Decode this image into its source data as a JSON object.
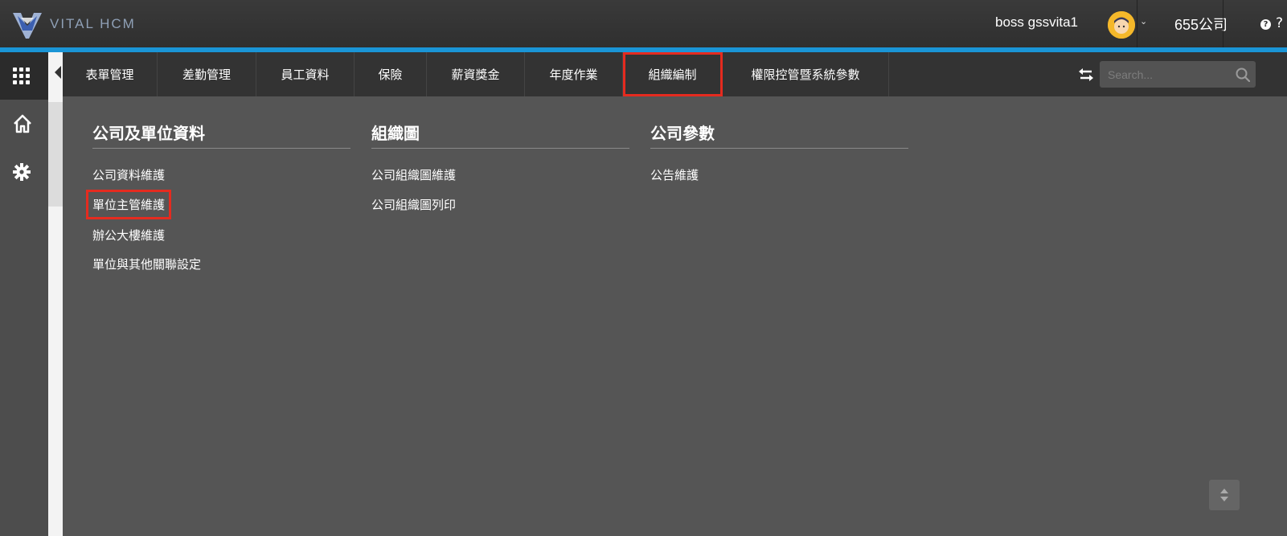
{
  "brand": {
    "name": "VITAL HCM"
  },
  "header": {
    "user_name": "boss gssvita1",
    "company": "655公司",
    "help_label": "?"
  },
  "nav": {
    "items": [
      {
        "label": "表單管理"
      },
      {
        "label": "差勤管理"
      },
      {
        "label": "員工資料"
      },
      {
        "label": "保險"
      },
      {
        "label": "薪資獎金"
      },
      {
        "label": "年度作業"
      },
      {
        "label": "組織編制",
        "highlighted": true
      },
      {
        "label": "權限控管暨系統參數"
      }
    ],
    "search_placeholder": "Search..."
  },
  "menu": {
    "columns": [
      {
        "title": "公司及單位資料",
        "links": [
          "公司資料維護",
          "單位主管維護",
          "辦公大樓維護",
          "單位與其他關聯設定"
        ],
        "highlighted_index": 1
      },
      {
        "title": "組織圖",
        "links": [
          "公司組織圖維護",
          "公司組織圖列印"
        ]
      },
      {
        "title": "公司參數",
        "links": [
          "公告維護"
        ]
      }
    ]
  },
  "colors": {
    "accent": "#1a95d6",
    "highlight": "#e52b1f",
    "avatar": "#f5b82a"
  },
  "icons": [
    "apps-grid-icon",
    "home-icon",
    "gear-icon",
    "swap-icon",
    "search-icon",
    "scroll-toggle-icon",
    "help-icon",
    "chevron-down-icon"
  ]
}
